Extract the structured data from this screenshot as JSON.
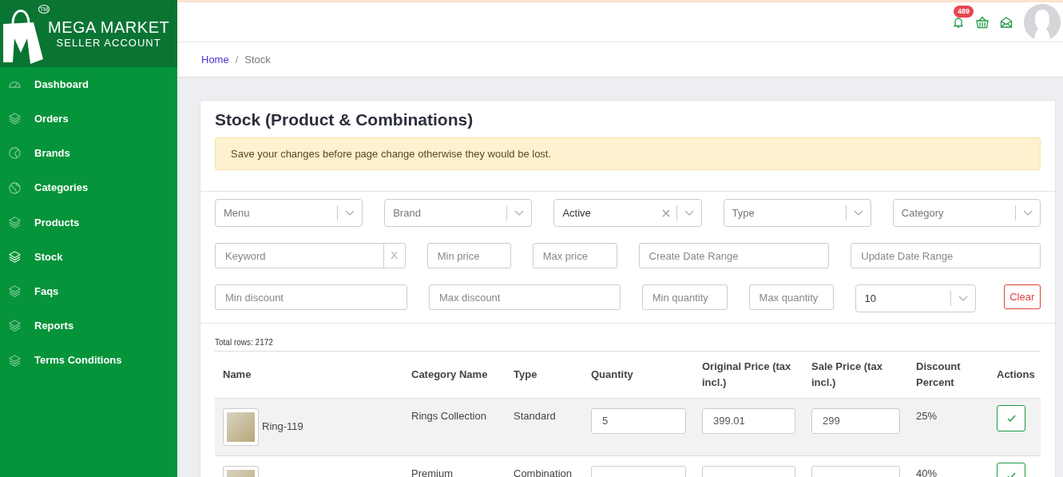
{
  "logo": {
    "title": "MEGA MARKET",
    "subtitle": "SELLER ACCOUNT",
    "tm_mark": "TM"
  },
  "sidebar": {
    "items": [
      {
        "label": "Dashboard",
        "selected": false
      },
      {
        "label": "Orders",
        "selected": false
      },
      {
        "label": "Brands",
        "selected": false
      },
      {
        "label": "Categories",
        "selected": false
      },
      {
        "label": "Products",
        "selected": false
      },
      {
        "label": "Stock",
        "selected": true
      },
      {
        "label": "Faqs",
        "selected": false
      },
      {
        "label": "Reports",
        "selected": false
      },
      {
        "label": "Terms Conditions",
        "selected": false
      }
    ]
  },
  "header": {
    "notification_count": "489"
  },
  "breadcrumb": [
    {
      "label": "Home",
      "current": false
    },
    {
      "label": "Stock",
      "current": true
    }
  ],
  "breadcrumb_separator": "/",
  "page_title": "Stock (Product & Combinations)",
  "alert": "Save your changes before page change otherwise they would be lost.",
  "filters": [
    [
      {
        "kind": "select",
        "placeholder": "Menu"
      },
      {
        "kind": "select",
        "placeholder": "Brand"
      },
      {
        "kind": "select",
        "value": "Active",
        "clearable": true
      },
      {
        "kind": "select",
        "placeholder": "Type"
      },
      {
        "kind": "select",
        "placeholder": "Category"
      }
    ],
    [
      {
        "kind": "input",
        "placeholder": "Keyword",
        "clear_label": "X"
      },
      {
        "kind": "input",
        "placeholder": "Min price"
      },
      {
        "kind": "input",
        "placeholder": "Max price"
      },
      {
        "kind": "input",
        "placeholder": "Create Date Range"
      },
      {
        "kind": "input",
        "placeholder": "Update Date Range"
      }
    ],
    [
      {
        "kind": "input",
        "placeholder": "Min discount"
      },
      {
        "kind": "input",
        "placeholder": "Max discount"
      },
      {
        "kind": "input",
        "placeholder": "Min quantity"
      },
      {
        "kind": "input",
        "placeholder": "Max quantity"
      },
      {
        "kind": "select",
        "value": "10"
      },
      {
        "kind": "button",
        "label": "Clear"
      }
    ]
  ],
  "total_rows": "Total rows: 2172",
  "table": {
    "columns": [
      "Name",
      "Category Name",
      "Type",
      "Quantity",
      "Original Price (tax incl.)",
      "Sale Price (tax incl.)",
      "Discount Percent",
      "Actions"
    ],
    "rows": [
      {
        "name": "Ring-119",
        "category": "Rings Collection",
        "type": "Standard",
        "quantity": "5",
        "original_price": "399.01",
        "sale_price": "299",
        "discount": "25%",
        "highlighted": true
      },
      {
        "category": "Premium",
        "type": "Combination",
        "discount": "40%",
        "highlighted": false
      }
    ]
  }
}
